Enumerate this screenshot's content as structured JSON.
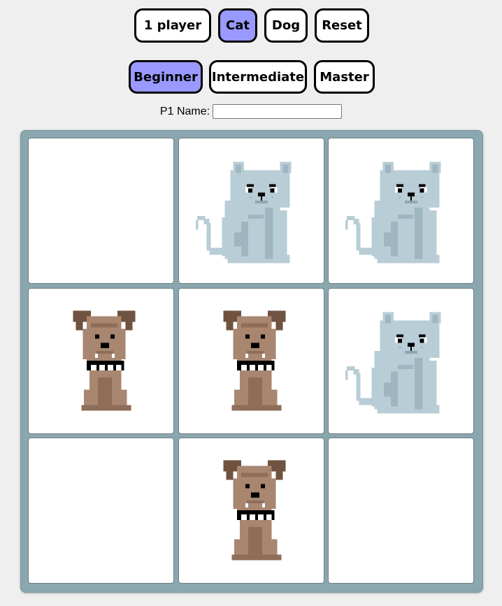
{
  "controls": {
    "mode_button": "1 player",
    "cat_button": "Cat",
    "dog_button": "Dog",
    "reset_button": "Reset"
  },
  "difficulty": {
    "beginner": "Beginner",
    "intermediate": "Intermediate",
    "master": "Master",
    "selected": "Beginner"
  },
  "player": {
    "name_label": "P1 Name:",
    "name_value": ""
  },
  "colors": {
    "active_button": "#9999ff",
    "board_background": "#8aa6ae"
  },
  "board": {
    "cells": [
      "",
      "cat",
      "cat",
      "dog",
      "dog",
      "cat",
      "",
      "dog",
      ""
    ]
  }
}
